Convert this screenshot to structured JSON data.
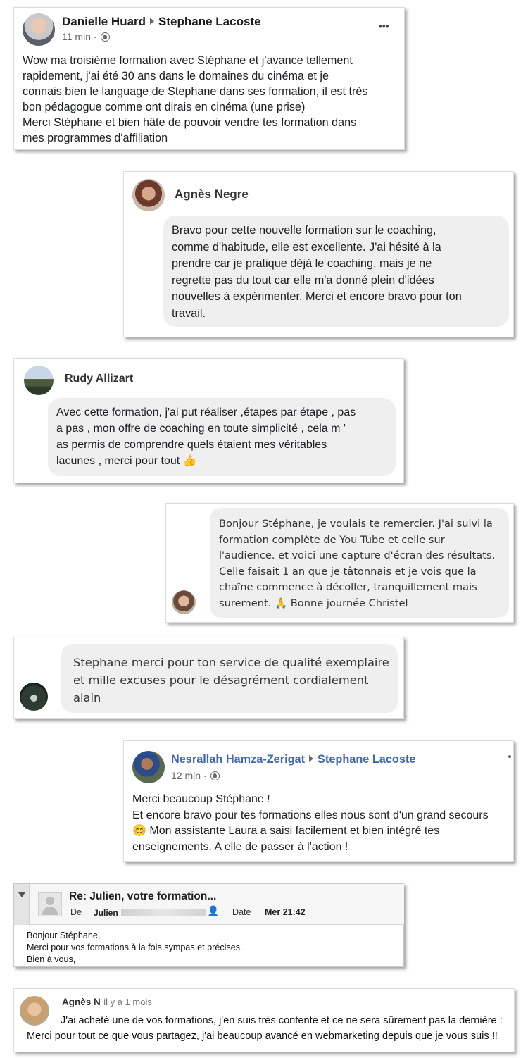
{
  "card1": {
    "author": "Danielle Huard",
    "target": "Stephane Lacoste",
    "time": "11 min",
    "menu": "•••",
    "lines": [
      "Wow ma troisième formation avec Stéphane et j'avance tellement",
      "rapidement, j'ai été 30 ans dans le domaines du cinéma et je",
      "connais bien le language de Stephane dans ses formation, il est très",
      "bon pédagogue comme ont dirais en cinéma (une prise)",
      "Merci Stéphane et bien hâte de pouvoir vendre tes formation dans",
      "mes programmes d'affiliation"
    ]
  },
  "card2": {
    "author": "Agnès Negre",
    "lines": [
      "Bravo pour cette nouvelle formation sur le coaching,",
      "comme d'habitude, elle est excellente. J'ai hésité à la",
      "prendre car je pratique déjà le coaching, mais je ne",
      "regrette pas du tout car elle m'a donné plein d'idées",
      "nouvelles à expérimenter. Merci et encore bravo pour ton",
      "travail."
    ]
  },
  "card3": {
    "author": "Rudy Allizart",
    "lines": [
      "Avec cette formation, j'ai put réaliser ,étapes par étape , pas",
      "a pas , mon offre de coaching en toute simplicité , cela m '",
      "as permis de comprendre quels étaient mes véritables",
      "lacunes , merci pour tout"
    ],
    "emoji": "👍"
  },
  "card4": {
    "lines": [
      "Bonjour Stéphane, je voulais te remercier. J'ai suivi la",
      "formation complète de You Tube et celle sur",
      "l'audience. et voici une capture d'écran des résultats.",
      "Celle faisait 1 an que je tâtonnais et je vois que la",
      "chaîne commence à décoller, tranquillement mais"
    ],
    "last_line": "surement.",
    "emoji": "🙏",
    "sign_off": "Bonne journée Christel"
  },
  "card5": {
    "lines": [
      "Stephane merci pour ton service de qualité exemplaire",
      "et mille excuses pour le désagrément cordialement",
      "alain"
    ]
  },
  "card6": {
    "author": "Nesrallah Hamza-Zerigat",
    "target": "Stephane Lacoste",
    "time": "12 min",
    "lines": [
      "Merci beaucoup Stéphane !",
      "Et encore bravo pour tes formations elles nous sont d'un grand secours"
    ],
    "emoji": "😊",
    "line3": "Mon assistante Laura a saisi facilement et bien intégré tes",
    "line4": "enseignements. A elle de passer à l'action !"
  },
  "card7": {
    "subject": "Re: Julien, votre formation...",
    "from_label": "De",
    "from_name": "Julien",
    "date_label": "Date",
    "date_value": "Mer 21:42",
    "lines": [
      "Bonjour Stéphane,",
      "Merci pour vos formations à la fois sympas et précises.",
      "Bien à vous,"
    ]
  },
  "card8": {
    "author": "Agnès N",
    "time": "il y a 1 mois",
    "lines": [
      "J'ai acheté une de vos formations, j'en suis très contente et ce ne sera sûrement pas la dernière :",
      "Merci pour tout ce que vous partagez, j'ai beaucoup avancé en webmarketing depuis que je vous suis !!"
    ]
  }
}
